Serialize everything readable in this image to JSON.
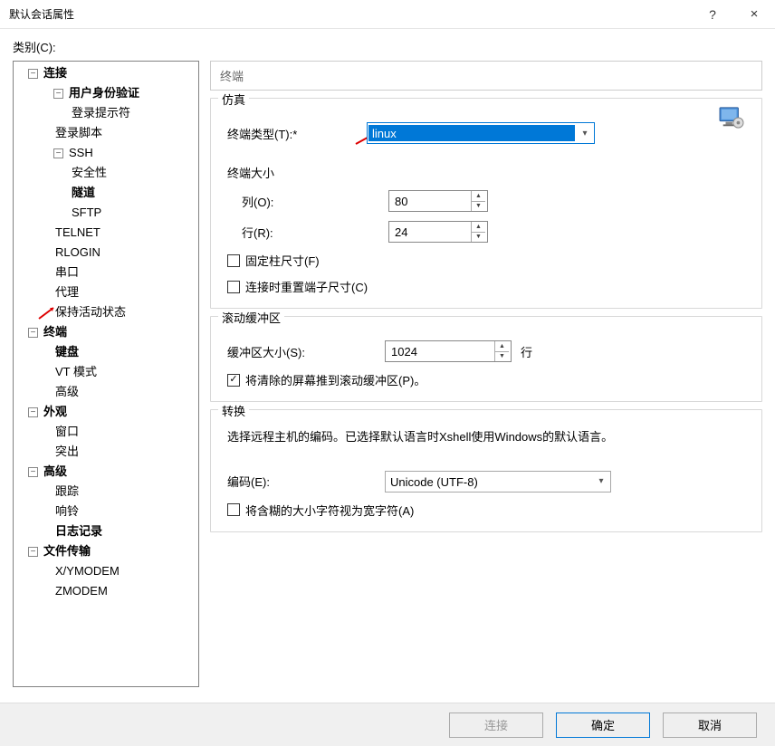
{
  "titlebar": {
    "title": "默认会话属性",
    "help": "?",
    "close": "×"
  },
  "category_label": "类别(C):",
  "tree": {
    "connection": "连接",
    "auth": "用户身份验证",
    "login_prompt": "登录提示符",
    "login_script": "登录脚本",
    "ssh": "SSH",
    "security": "安全性",
    "tunnel": "隧道",
    "sftp": "SFTP",
    "telnet": "TELNET",
    "rlogin": "RLOGIN",
    "serial": "串口",
    "proxy": "代理",
    "keepalive": "保持活动状态",
    "terminal": "终端",
    "keyboard": "键盘",
    "vtmode": "VT 模式",
    "advanced_term": "高级",
    "appearance": "外观",
    "window": "窗口",
    "highlight": "突出",
    "advanced": "高级",
    "trace": "跟踪",
    "bell": "响铃",
    "logging": "日志记录",
    "filetransfer": "文件传输",
    "xymodem": "X/YMODEM",
    "zmodem": "ZMODEM"
  },
  "right": {
    "heading": "终端",
    "emulation": {
      "group_title": "仿真",
      "type_label": "终端类型(T):*",
      "type_value": "linux",
      "size_title": "终端大小",
      "cols_label": "列(O):",
      "cols_value": "80",
      "rows_label": "行(R):",
      "rows_value": "24",
      "fixed_cols_label": "固定柱尺寸(F)",
      "reset_on_connect_label": "连接时重置端子尺寸(C)"
    },
    "scroll": {
      "group_title": "滚动缓冲区",
      "size_label": "缓冲区大小(S):",
      "size_value": "1024",
      "unit": "行",
      "push_label": "将清除的屏幕推到滚动缓冲区(P)。"
    },
    "translate": {
      "group_title": "转换",
      "note": "选择远程主机的编码。已选择默认语言时Xshell使用Windows的默认语言。",
      "encoding_label": "编码(E):",
      "encoding_value": "Unicode (UTF-8)",
      "ambiguous_label": "将含糊的大小字符视为宽字符(A)"
    }
  },
  "footer": {
    "connect": "连接",
    "ok": "确定",
    "cancel": "取消"
  }
}
